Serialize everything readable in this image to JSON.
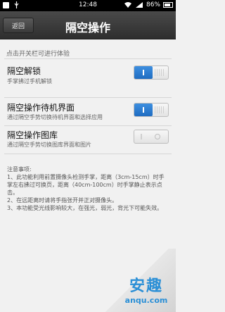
{
  "status_bar": {
    "time": "12:48",
    "battery": "86%"
  },
  "header": {
    "back_label": "返回",
    "title": "隔空操作"
  },
  "hint": "点击开关栏可进行体验",
  "settings": [
    {
      "title": "隔空解锁",
      "subtitle": "手掌拂过手机解锁",
      "enabled": true
    },
    {
      "title": "隔空操作待机界面",
      "subtitle": "通过隔空手势切换待机界面和选择应用",
      "enabled": true
    },
    {
      "title": "隔空操作图库",
      "subtitle": "通过隔空手势切换图库界面和图片",
      "enabled": false
    }
  ],
  "notes": {
    "heading": "注意事项:",
    "lines": [
      "1、此功能利用前置摄像头检测手掌，距离（3cm-15cm）时手",
      "掌左右拂过可换页，距离（40cm-100cm）时手掌静止表示点",
      "击。",
      "2、在远距离时请将手指张开并正对摄像头。",
      "3、本功能受光线影响较大，在强光，弱光，背光下可能失效。"
    ]
  },
  "watermark": {
    "brand": "安趣",
    "url": "anqu.com"
  },
  "colors": {
    "accent": "#2a7fd4",
    "title_bar": "#3a3a3a"
  }
}
